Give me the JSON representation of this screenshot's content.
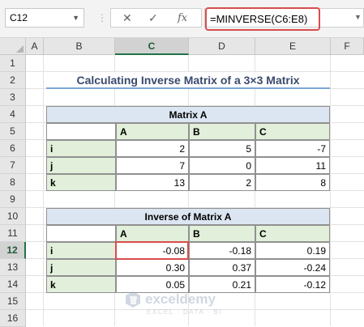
{
  "formula_bar": {
    "name_box": "C12",
    "cancel_icon": "✕",
    "enter_icon": "✓",
    "fx_label": "fx",
    "formula": "=MINVERSE(C6:E8)"
  },
  "columns": [
    "A",
    "B",
    "C",
    "D",
    "E",
    "F"
  ],
  "rows": [
    "1",
    "2",
    "3",
    "4",
    "5",
    "6",
    "7",
    "8",
    "9",
    "10",
    "11",
    "12",
    "13",
    "14",
    "15",
    "16"
  ],
  "title": "Calculating Inverse Matrix of a 3×3 Matrix",
  "matrix_a": {
    "caption": "Matrix A",
    "headers": [
      "A",
      "B",
      "C"
    ],
    "rows": [
      {
        "label": "i",
        "values": [
          "2",
          "5",
          "-7"
        ]
      },
      {
        "label": "j",
        "values": [
          "7",
          "0",
          "11"
        ]
      },
      {
        "label": "k",
        "values": [
          "13",
          "2",
          "8"
        ]
      }
    ]
  },
  "inverse": {
    "caption": "Inverse of Matrix A",
    "headers": [
      "A",
      "B",
      "C"
    ],
    "rows": [
      {
        "label": "i",
        "values": [
          "-0.08",
          "-0.18",
          "0.19"
        ]
      },
      {
        "label": "j",
        "values": [
          "0.30",
          "0.37",
          "-0.24"
        ]
      },
      {
        "label": "k",
        "values": [
          "0.05",
          "0.21",
          "-0.12"
        ]
      }
    ]
  },
  "watermark": {
    "name": "exceldemy",
    "tag": "EXCEL · DATA · BI"
  },
  "colors": {
    "accent_green": "#217346",
    "highlight_red": "#d94c4c",
    "header_blue": "#dce6f2",
    "label_green": "#e2efda"
  }
}
